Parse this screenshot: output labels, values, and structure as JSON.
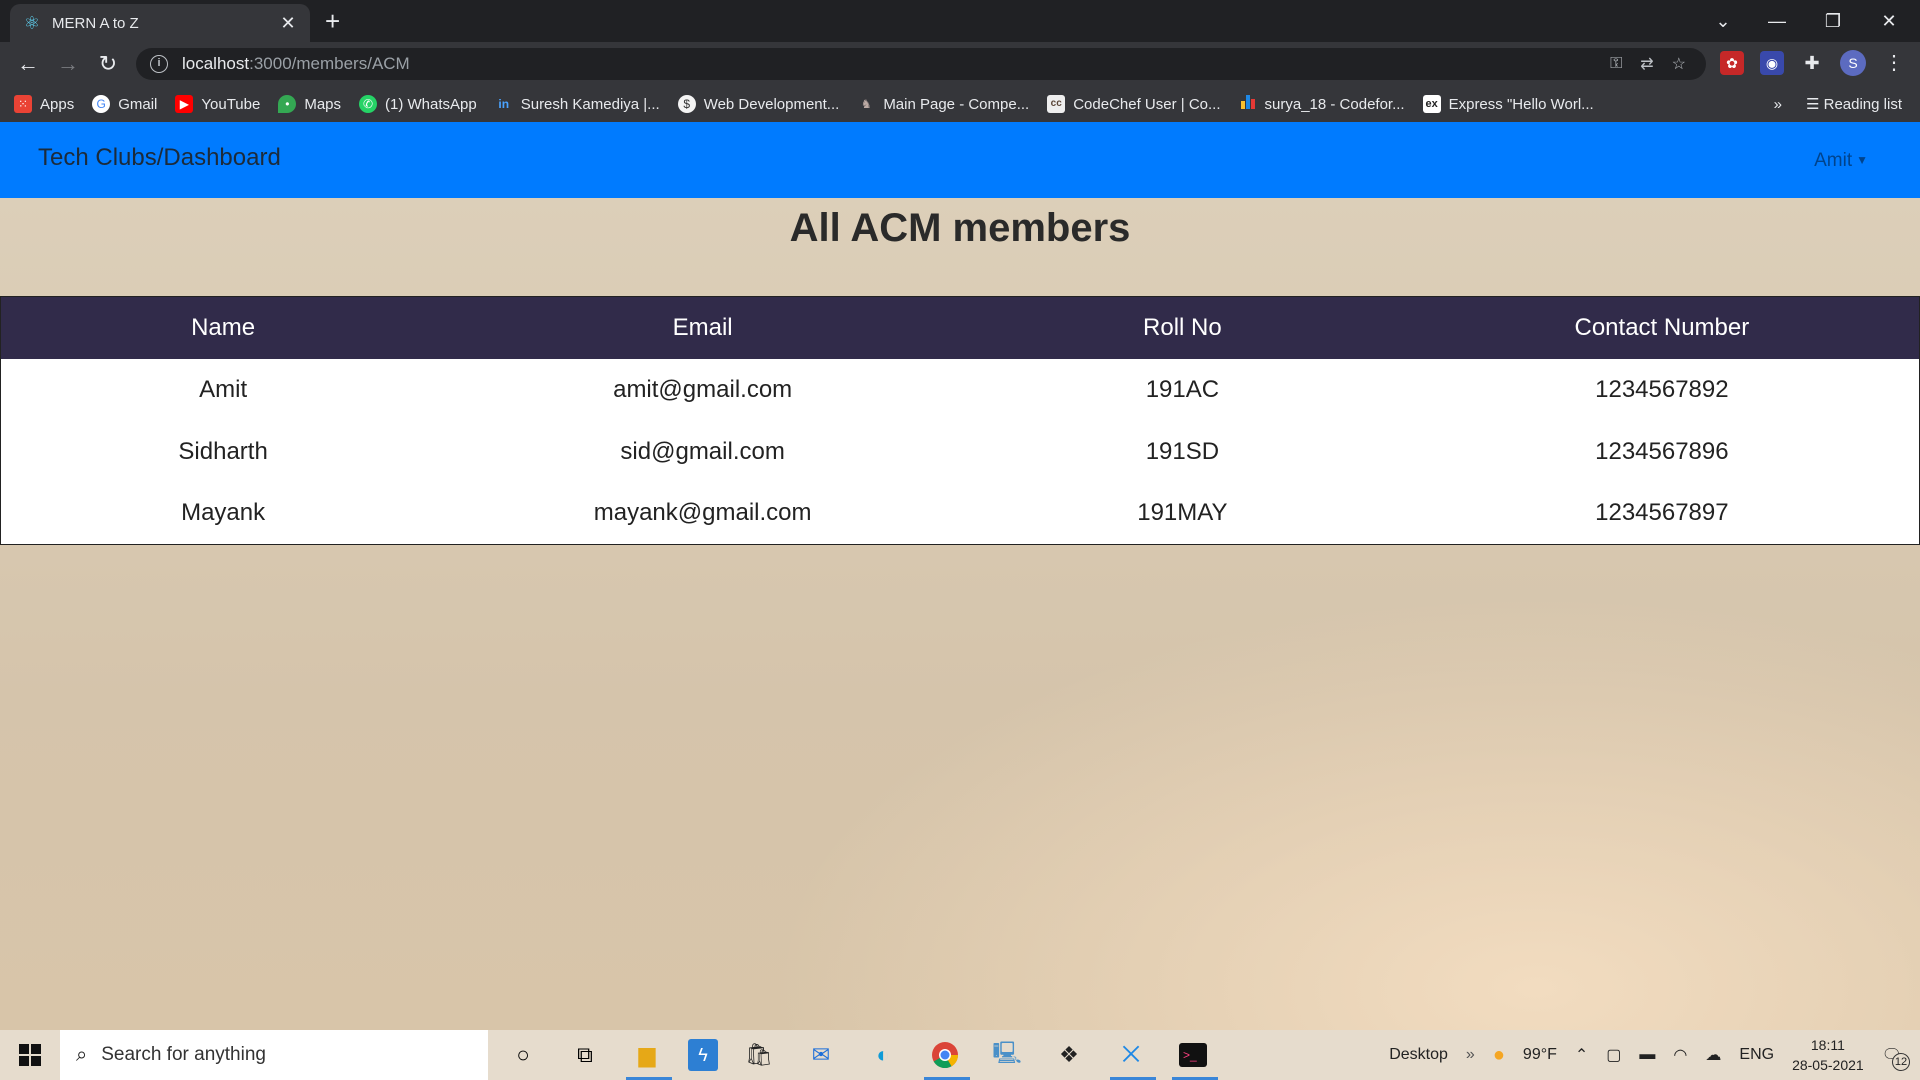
{
  "browser": {
    "tab_title": "MERN A to Z",
    "tab_close": "✕",
    "new_tab": "+",
    "url_host": "localhost",
    "url_path": ":3000/members/ACM",
    "bookmarks": [
      {
        "label": "Apps",
        "icon": "apps-grid-icon",
        "color": "#ea4335"
      },
      {
        "label": "Gmail",
        "icon": "google-icon",
        "color": "#ffffff"
      },
      {
        "label": "YouTube",
        "icon": "youtube-icon",
        "color": "#ff0000"
      },
      {
        "label": "Maps",
        "icon": "maps-pin-icon",
        "color": "#34a853"
      },
      {
        "label": "(1) WhatsApp",
        "icon": "whatsapp-icon",
        "color": "#25d366"
      },
      {
        "label": "Suresh Kamediya |...",
        "icon": "linkedin-icon",
        "color": "#0a66c2"
      },
      {
        "label": "Web Development...",
        "icon": "udemy-icon",
        "color": "#f4c430"
      },
      {
        "label": "Main Page - Compe...",
        "icon": "cp-algorithms-icon",
        "color": "#8d6e63"
      },
      {
        "label": "CodeChef User | Co...",
        "icon": "codechef-icon",
        "color": "#5b4638"
      },
      {
        "label": "surya_18 - Codefor...",
        "icon": "codeforces-icon",
        "color": "#1e88e5"
      },
      {
        "label": "Express \"Hello Worl...",
        "icon": "express-icon",
        "color": "#ffffff"
      }
    ],
    "more_bookmarks": "»",
    "reading_list": "Reading list",
    "profile_initial": "S"
  },
  "app": {
    "brand": "Tech Clubs/Dashboard",
    "user_menu": "Amit",
    "page_title": "All ACM members",
    "table": {
      "headers": [
        "Name",
        "Email",
        "Roll No",
        "Contact Number"
      ],
      "rows": [
        [
          "Amit",
          "amit@gmail.com",
          "191AC",
          "1234567892"
        ],
        [
          "Sidharth",
          "sid@gmail.com",
          "191SD",
          "1234567896"
        ],
        [
          "Mayank",
          "mayank@gmail.com",
          "191MAY",
          "1234567897"
        ]
      ]
    }
  },
  "taskbar": {
    "search_placeholder": "Search for anything",
    "desktop_label": "Desktop",
    "weather": "99°F",
    "language": "ENG",
    "time": "18:11",
    "date": "28-05-2021",
    "notification_count": "12"
  }
}
